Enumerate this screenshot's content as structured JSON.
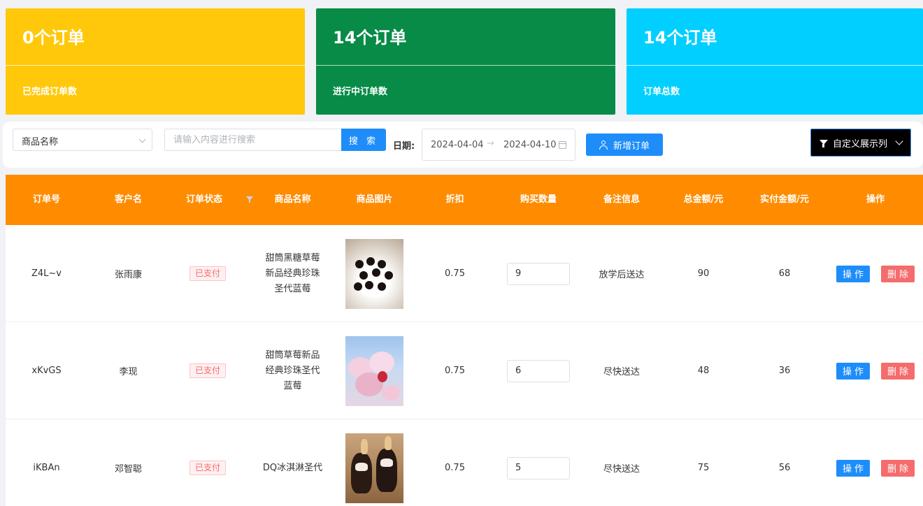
{
  "stats": [
    {
      "value": "0个订单",
      "label": "已完成订单数",
      "color": "#ffc80a"
    },
    {
      "value": "14个订单",
      "label": "进行中订单数",
      "color": "#078b47"
    },
    {
      "value": "14个订单",
      "label": "订单总数",
      "color": "#00cfff"
    }
  ],
  "toolbar": {
    "select_value": "商品名称",
    "search_placeholder": "请输入内容进行搜索",
    "search_button": "搜 索",
    "date_label": "日期:",
    "date_start": "2024-04-04",
    "date_sep": "→",
    "date_end": "2024-04-10",
    "add_button": "新增订单",
    "custom_button": "自定义展示列"
  },
  "table": {
    "headers": [
      "订单号",
      "客户名",
      "订单状态",
      "商品名称",
      "商品图片",
      "折扣",
      "购买数量",
      "备注信息",
      "总金额/元",
      "实付金额/元",
      "操作"
    ],
    "rows": [
      {
        "order_id": "Z4L~v",
        "customer": "张雨康",
        "status": "已支付",
        "product": "甜筒黑糖草莓新品经典珍珠圣代蓝莓",
        "discount": "0.75",
        "qty": "9",
        "note": "放学后送达",
        "total": "90",
        "paid": "68",
        "op": "操作",
        "del": "删除"
      },
      {
        "order_id": "xKvGS",
        "customer": "李现",
        "status": "已支付",
        "product": "甜筒草莓新品经典珍珠圣代蓝莓",
        "discount": "0.75",
        "qty": "6",
        "note": "尽快送达",
        "total": "48",
        "paid": "36",
        "op": "操作",
        "del": "删除"
      },
      {
        "order_id": "iKBAn",
        "customer": "邓智聪",
        "status": "已支付",
        "product": "DQ冰淇淋圣代",
        "discount": "0.75",
        "qty": "5",
        "note": "尽快送达",
        "total": "75",
        "paid": "56",
        "op": "操作",
        "del": "删除"
      }
    ]
  },
  "colors": {
    "header": "#ff8c00",
    "primary": "#1e8dfa",
    "danger": "#f56c6c"
  }
}
